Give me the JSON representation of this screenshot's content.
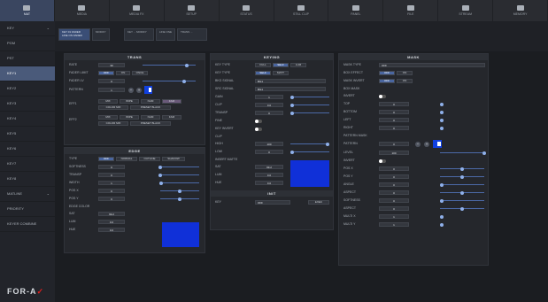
{
  "tabs": [
    {
      "label": "MAT"
    },
    {
      "label": "MEDIA"
    },
    {
      "label": "MEDIA FX"
    },
    {
      "label": "SETUP"
    },
    {
      "label": "STATUS"
    },
    {
      "label": "STILL CLIP"
    },
    {
      "label": "PANEL"
    },
    {
      "label": "FILE"
    },
    {
      "label": "STREAM"
    },
    {
      "label": "MEMORY"
    }
  ],
  "sidebar": {
    "items": [
      {
        "label": "KEY"
      },
      {
        "label": "PGM"
      },
      {
        "label": "PST"
      },
      {
        "label": "KEY1"
      },
      {
        "label": "KEY2"
      },
      {
        "label": "KEY3"
      },
      {
        "label": "KEY4"
      },
      {
        "label": "KEY5"
      },
      {
        "label": "KEY6"
      },
      {
        "label": "KEY7"
      },
      {
        "label": "KEY8"
      },
      {
        "label": "MATLINE"
      },
      {
        "label": "PRIORITY"
      },
      {
        "label": "KEYER COMBINE"
      }
    ],
    "logo": "FOR-A"
  },
  "subbar": {
    "chips": [
      {
        "label": "KEY 01 FADER LINE ON FADER"
      },
      {
        "label": "MODIFY"
      },
      {
        "label": "KEY ... MODIFY"
      },
      {
        "label": "LINE ONE"
      },
      {
        "label": "TRANS ..."
      }
    ]
  },
  "trans": {
    "title": "TRANS",
    "rows": [
      {
        "label": "RATE",
        "value": "30"
      },
      {
        "label": "FADER LIMIT",
        "opts": [
          "OFF",
          "ON",
          "ONCE"
        ]
      },
      {
        "label": "FADER LV",
        "value": "0"
      },
      {
        "label": "PATTERN",
        "value": "1"
      },
      {
        "label": "EFF1",
        "opts": [
          "MIX",
          "WIPE",
          "NAM",
          "FAM"
        ]
      },
      {
        "label": "",
        "opts": [
          "COLOR MIX",
          "PRESET BLACK"
        ]
      },
      {
        "label": "EFF2",
        "opts": [
          "MIX",
          "WIPE",
          "NAM",
          "FAM"
        ]
      },
      {
        "label": "",
        "opts": [
          "COLOR MIX",
          "PRESET BLACK"
        ]
      }
    ]
  },
  "edge": {
    "title": "EDGE",
    "rows": [
      {
        "label": "TYPE",
        "opts": [
          "OFF",
          "NORMAL",
          "OUTLINE",
          "SHADOW"
        ]
      },
      {
        "label": "SOFTNESS",
        "value": "0"
      },
      {
        "label": "TRANSP",
        "value": "0"
      },
      {
        "label": "WIDTH",
        "value": "1"
      },
      {
        "label": "POS X",
        "value": "0"
      },
      {
        "label": "POS Y",
        "value": "0"
      },
      {
        "label": "EDGE COLOR",
        "value": ""
      },
      {
        "label": "SAT",
        "value": "99.2"
      },
      {
        "label": "LUM",
        "value": "0.0"
      },
      {
        "label": "HUE",
        "value": "0.0"
      }
    ]
  },
  "keying": {
    "title": "KEYING",
    "rows": [
      {
        "label": "KEY TYPE",
        "opts": [
          "FULL",
          "SELF",
          "LUM"
        ]
      },
      {
        "label": "KEY TYPE",
        "opts": [
          "SELF",
          "MATT"
        ]
      },
      {
        "label": "BKG SIGNAL",
        "value": "BG1"
      },
      {
        "label": "SRC SIGNAL",
        "value": "BG1"
      },
      {
        "label": "GAIN",
        "value": "1"
      },
      {
        "label": "CLIP",
        "value": "0.0"
      },
      {
        "label": "TRANSP",
        "value": "0"
      },
      {
        "label": "FINE",
        "value": ""
      },
      {
        "label": "KEY INVERT",
        "value": ""
      },
      {
        "label": "CLIP",
        "value": ""
      },
      {
        "label": "HIGH",
        "value": "100"
      },
      {
        "label": "LOW",
        "value": "0"
      },
      {
        "label": "INSERT MATTE",
        "value": ""
      },
      {
        "label": "SAT",
        "value": "99.2"
      },
      {
        "label": "LUM",
        "value": "0.0"
      },
      {
        "label": "HUE",
        "value": "0.0"
      }
    ]
  },
  "init": {
    "title": "INIT",
    "key": "KEY",
    "value": "OFF",
    "exec": "EXEC"
  },
  "mask": {
    "title": "MASK",
    "rows": [
      {
        "label": "MASK TYPE",
        "value": "OFF"
      },
      {
        "label": "BOX EFFECT",
        "opts": [
          "OFF",
          "ON"
        ]
      },
      {
        "label": "MASK INVERT",
        "opts": [
          "OFF",
          "ON"
        ]
      },
      {
        "label": "BOX MASK",
        "value": ""
      },
      {
        "label": "INVERT",
        "value": ""
      },
      {
        "label": "TOP",
        "value": "0"
      },
      {
        "label": "BOTTOM",
        "value": "0"
      },
      {
        "label": "LEFT",
        "value": "0"
      },
      {
        "label": "RIGHT",
        "value": "0"
      },
      {
        "label": "PATTERN MASK",
        "value": ""
      },
      {
        "label": "PATTERN",
        "value": "0"
      },
      {
        "label": "LEVEL",
        "value": "100"
      },
      {
        "label": "INVERT",
        "value": ""
      },
      {
        "label": "POS X",
        "value": "0"
      },
      {
        "label": "POS Y",
        "value": "0"
      },
      {
        "label": "ANGLE",
        "value": "0"
      },
      {
        "label": "ASPECT",
        "value": "0"
      },
      {
        "label": "SOFTNESS",
        "value": "0"
      },
      {
        "label": "ASPECT",
        "value": "0"
      },
      {
        "label": "MULTI X",
        "value": "1"
      },
      {
        "label": "MULTI Y",
        "value": "1"
      }
    ]
  }
}
